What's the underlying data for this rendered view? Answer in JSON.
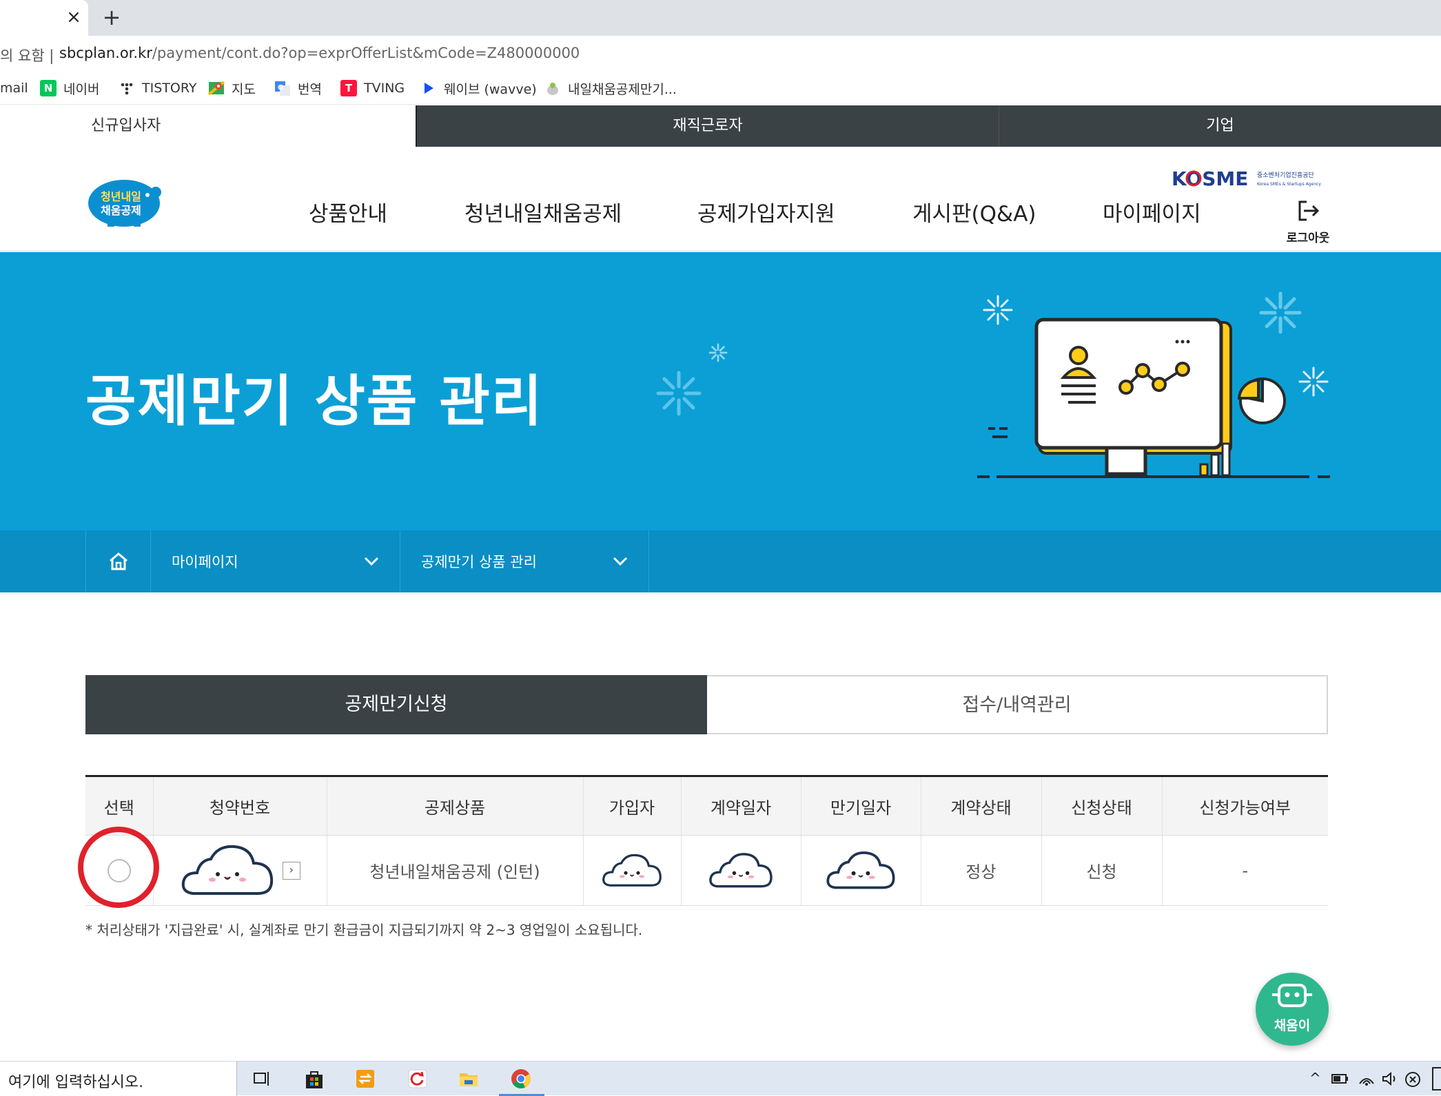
{
  "browser": {
    "tab_close": "×",
    "new_tab": "+",
    "address_prefix": "의 요함 |",
    "url_host": "sbcplan.or.kr",
    "url_path": "/payment/cont.do?op=exprOfferList&mCode=Z480000000",
    "bookmarks": [
      {
        "label": "mail",
        "icon": "mail-icon"
      },
      {
        "label": "네이버",
        "icon": "naver-icon",
        "color": "#03c75a"
      },
      {
        "label": "TISTORY",
        "icon": "tistory-icon"
      },
      {
        "label": "지도",
        "icon": "maps-icon"
      },
      {
        "label": "번역",
        "icon": "translate-icon"
      },
      {
        "label": "TVING",
        "icon": "tving-icon",
        "color": "#ff153c"
      },
      {
        "label": "웨이브 (wavve)",
        "icon": "wavve-icon",
        "color": "#1351f9"
      },
      {
        "label": "내일채움공제만기...",
        "icon": "pig-icon"
      }
    ]
  },
  "site_tabs": {
    "new_employee": "신규입사자",
    "employee": "재직근로자",
    "company": "기업"
  },
  "gnb": {
    "logo_text_line1": "청년내일",
    "logo_text_line2": "채움공제",
    "items": [
      "상품안내",
      "청년내일채움공제",
      "공제가입자지원",
      "게시판(Q&A)",
      "마이페이지"
    ],
    "kosme": "KOSME",
    "kosme_sub": "중소벤처기업진흥공단",
    "kosme_sub_en": "Korea SMEs & Startups Agency",
    "logout": "로그아웃"
  },
  "hero": {
    "title": "공제만기 상품 관리",
    "bg_color": "#0b9fd6"
  },
  "breadcrumb": {
    "home_icon": "home-icon",
    "level1": "마이페이지",
    "level2": "공제만기 상품 관리"
  },
  "content_tabs": {
    "active": "공제만기신청",
    "inactive": "접수/내역관리"
  },
  "table": {
    "headers": [
      "선택",
      "청약번호",
      "공제상품",
      "가입자",
      "계약일자",
      "만기일자",
      "계약상태",
      "신청상태",
      "신청가능여부"
    ],
    "rows": [
      {
        "product": "청년내일채움공제 (인턴)",
        "contract_status": "정상",
        "apply_status": "신청",
        "eligibility": "-"
      }
    ]
  },
  "note": "* 처리상태가 '지급완료' 시, 실계좌로 만기 환급금이 지급되기까지 약 2~3 영업일이 소요됩니다.",
  "chatbot": {
    "label": "채움이",
    "color": "#2fb88e"
  },
  "taskbar": {
    "search_placeholder": "여기에 입력하십시오."
  }
}
